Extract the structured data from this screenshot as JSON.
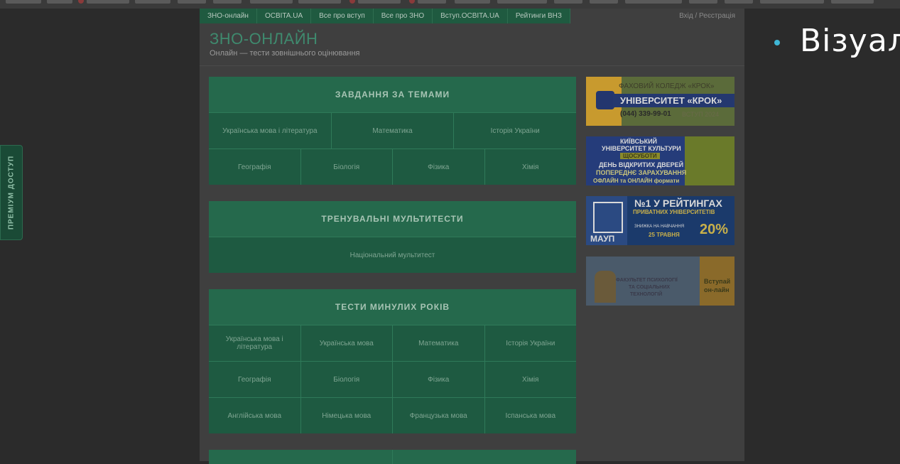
{
  "slide": {
    "text": "Візуал"
  },
  "premium": {
    "label": "ПРЕМІУМ ДОСТУП"
  },
  "nav": {
    "items": [
      "ЗНО-онлайн",
      "OCBITA.UA",
      "Все про вступ",
      "Все про ЗНО",
      "Вступ.OCBITA.UA",
      "Рейтинги ВНЗ"
    ],
    "login": "Вхід / Реєстрація"
  },
  "header": {
    "title": "ЗНО-ОНЛАЙН",
    "subtitle": "Онлайн — тести зовнішнього оцінювання"
  },
  "sections": {
    "topics": {
      "title": "ЗАВДАННЯ ЗА ТЕМАМИ",
      "row1": [
        "Українська мова і література",
        "Математика",
        "Історія України"
      ],
      "row2": [
        "Географія",
        "Біологія",
        "Фізика",
        "Хімія"
      ]
    },
    "multitests": {
      "title": "ТРЕНУВАЛЬНІ МУЛЬТИТЕСТИ",
      "row1": [
        "Національний мультитест"
      ]
    },
    "past": {
      "title": "ТЕСТИ МИНУЛИХ РОКІВ",
      "row1": [
        "Українська мова і література",
        "Українська мова",
        "Математика",
        "Історія України"
      ],
      "row2": [
        "Географія",
        "Біологія",
        "Фізика",
        "Хімія"
      ],
      "row3": [
        "Англійська мова",
        "Німецька мова",
        "Французька мова",
        "Іспанська мова"
      ]
    }
  },
  "ads": {
    "ad1": {
      "line1": "ФАХОВИЙ КОЛЕДЖ «КРОК»",
      "line2": "УНІВЕРСИТЕТ «КРОК»",
      "line3": "(044) 339-99-01",
      "line4": "ВСТУП 2024"
    },
    "ad2": {
      "line1": "КИЇВСЬКИЙ",
      "line2": "УНІВЕРСИТЕТ КУЛЬТУРИ",
      "line3": "ЩОСУБОТИ",
      "line4": "ДЕНЬ ВІДКРИТИХ ДВЕРЕЙ",
      "line5": "ПОПЕРЕДНЄ ЗАРАХУВАННЯ",
      "line6": "ОФЛАЙН та ОНЛАЙН формати"
    },
    "ad3": {
      "line1": "№1 У РЕЙТИНГАХ",
      "line2": "ПРИВАТНИХ УНІВЕРСИТЕТІВ",
      "line3": "ЗНИЖКА НА НАВЧАННЯ",
      "line4": "25 ТРАВНЯ",
      "line5": "20%",
      "logo": "МАУП"
    },
    "ad4": {
      "line1": "ФАКУЛЬТЕТ ПСИХОЛОГІЇ",
      "line2": "ТА СОЦІАЛЬНИХ",
      "line3": "ТЕХНОЛОГІЙ",
      "line4": "Вступай",
      "line5": "он-лайн"
    }
  }
}
